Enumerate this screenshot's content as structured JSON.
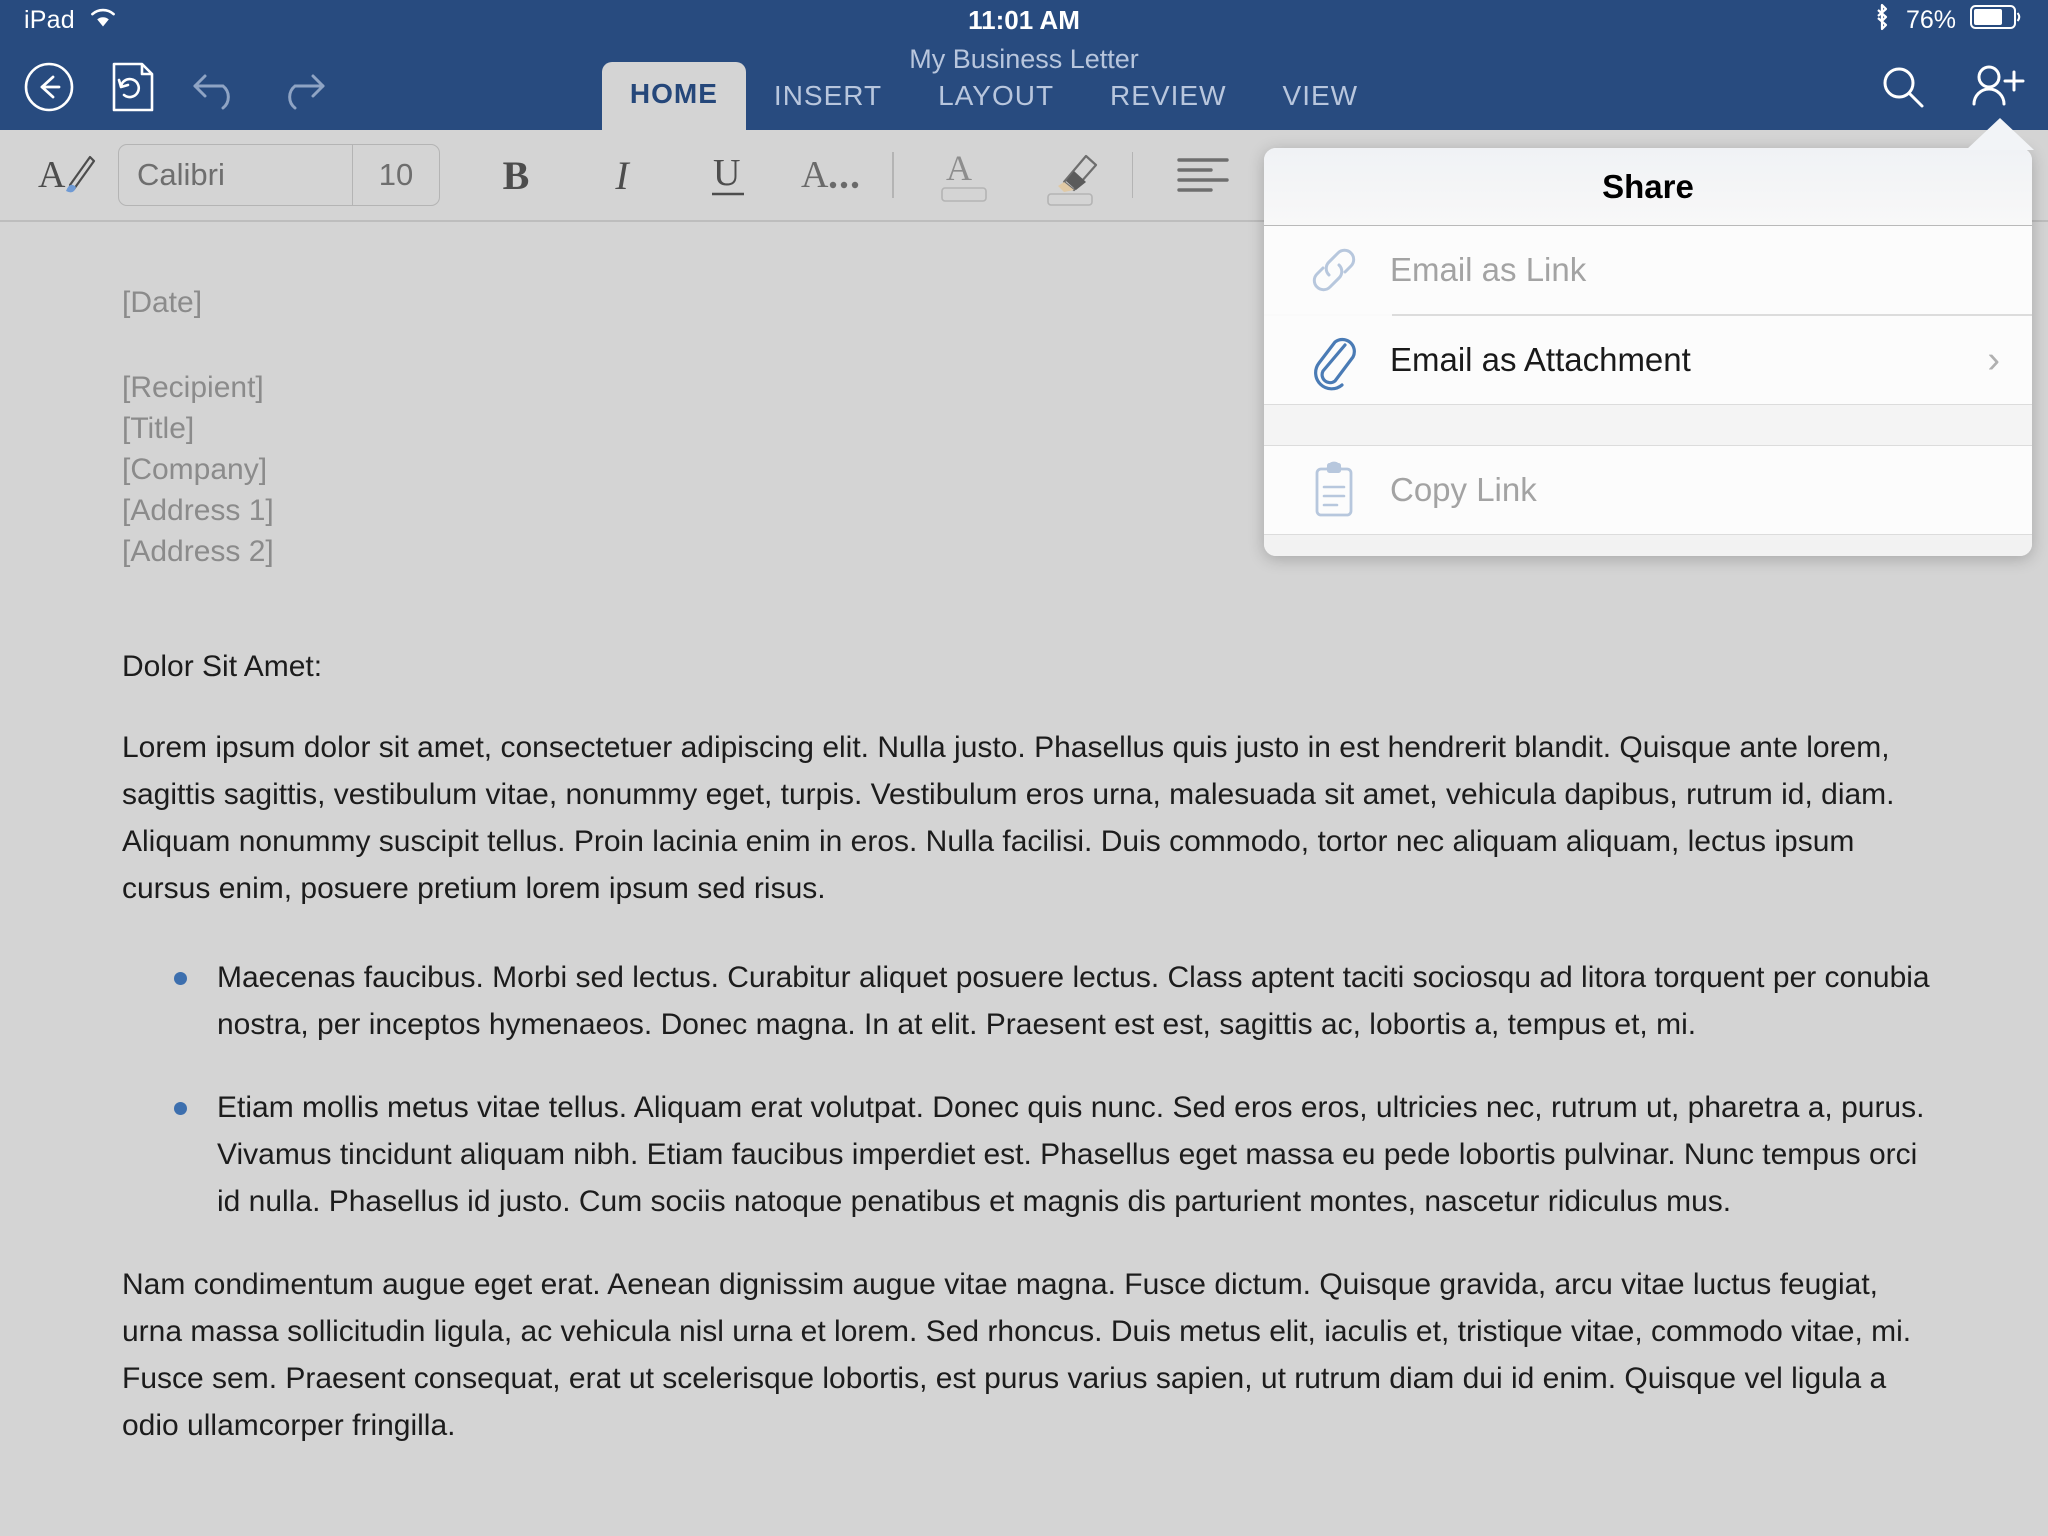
{
  "status_bar": {
    "device": "iPad",
    "wifi_icon": "wifi-icon",
    "time": "11:01 AM",
    "bluetooth_icon": "bluetooth-icon",
    "battery_percent": "76%",
    "battery_icon": "battery-icon"
  },
  "navbar": {
    "document_title": "My Business Letter",
    "back_icon": "back-arrow-icon",
    "save_icon": "save-document-icon",
    "undo_icon": "undo-icon",
    "redo_icon": "redo-icon",
    "search_icon": "search-icon",
    "share_icon": "share-person-add-icon",
    "accent_color": "#284b7f"
  },
  "tabs": [
    {
      "label": "HOME",
      "active": true
    },
    {
      "label": "INSERT",
      "active": false
    },
    {
      "label": "LAYOUT",
      "active": false
    },
    {
      "label": "REVIEW",
      "active": false
    },
    {
      "label": "VIEW",
      "active": false
    }
  ],
  "toolbar": {
    "format_painter_icon": "format-painter-icon",
    "font_name": "Calibri",
    "font_size": "10",
    "bold_label": "B",
    "italic_label": "I",
    "underline_label": "U",
    "more_font_label": "A...",
    "font_color_icon": "font-color-icon",
    "highlight_icon": "text-highlight-icon",
    "align_left_icon": "align-left-icon",
    "align_center_icon": "align-center-icon"
  },
  "document": {
    "placeholders": [
      "[Date]",
      "[Recipient]",
      "[Title]",
      "[Company]",
      "[Address 1]",
      "[Address 2]"
    ],
    "salutation": "Dolor Sit Amet:",
    "paragraph_1": "Lorem ipsum dolor sit amet, consectetuer adipiscing elit. Nulla justo. Phasellus quis justo in est hendrerit blandit. Quisque ante lorem, sagittis sagittis, vestibulum vitae, nonummy eget, turpis. Vestibulum eros urna, malesuada sit amet, vehicula dapibus, rutrum id, diam. Aliquam nonummy suscipit tellus. Proin lacinia enim in eros. Nulla facilisi. Duis commodo, tortor nec aliquam aliquam, lectus ipsum cursus enim, posuere pretium lorem ipsum sed risus.",
    "bullets": [
      "Maecenas faucibus. Morbi sed lectus. Curabitur aliquet posuere lectus. Class aptent taciti sociosqu ad litora torquent per conubia nostra, per inceptos hymenaeos. Donec magna. In at elit. Praesent est est, sagittis ac, lobortis a, tempus et, mi.",
      "Etiam mollis metus vitae tellus. Aliquam erat volutpat. Donec quis nunc. Sed eros eros, ultricies nec, rutrum ut, pharetra a, purus. Vivamus tincidunt aliquam nibh. Etiam faucibus imperdiet est. Phasellus eget massa eu pede lobortis pulvinar. Nunc tempus orci id nulla. Phasellus id justo. Cum sociis natoque penatibus et magnis dis parturient montes, nascetur ridiculus mus."
    ],
    "paragraph_2": "Nam condimentum augue eget erat. Aenean dignissim augue vitae magna. Fusce dictum. Quisque gravida, arcu vitae luctus feugiat, urna massa sollicitudin ligula, ac vehicula nisl urna et lorem. Sed rhoncus. Duis metus elit, iaculis et, tristique vitae, commodo vitae, mi. Fusce sem. Praesent consequat, erat ut scelerisque lobortis, est purus varius sapien, ut rutrum diam dui id enim. Quisque vel ligula a odio ullamcorper fringilla.",
    "bullet_color": "#3d6fae",
    "placeholder_color": "#8b8b8b"
  },
  "share_popover": {
    "title": "Share",
    "items": [
      {
        "label": "Email as Link",
        "icon": "chain-link-icon",
        "disabled": true,
        "chevron": false
      },
      {
        "label": "Email as Attachment",
        "icon": "paperclip-icon",
        "disabled": false,
        "chevron": true
      },
      {
        "label": "Copy Link",
        "icon": "clipboard-icon",
        "disabled": true,
        "chevron": false
      }
    ],
    "chevron_glyph": "›"
  }
}
